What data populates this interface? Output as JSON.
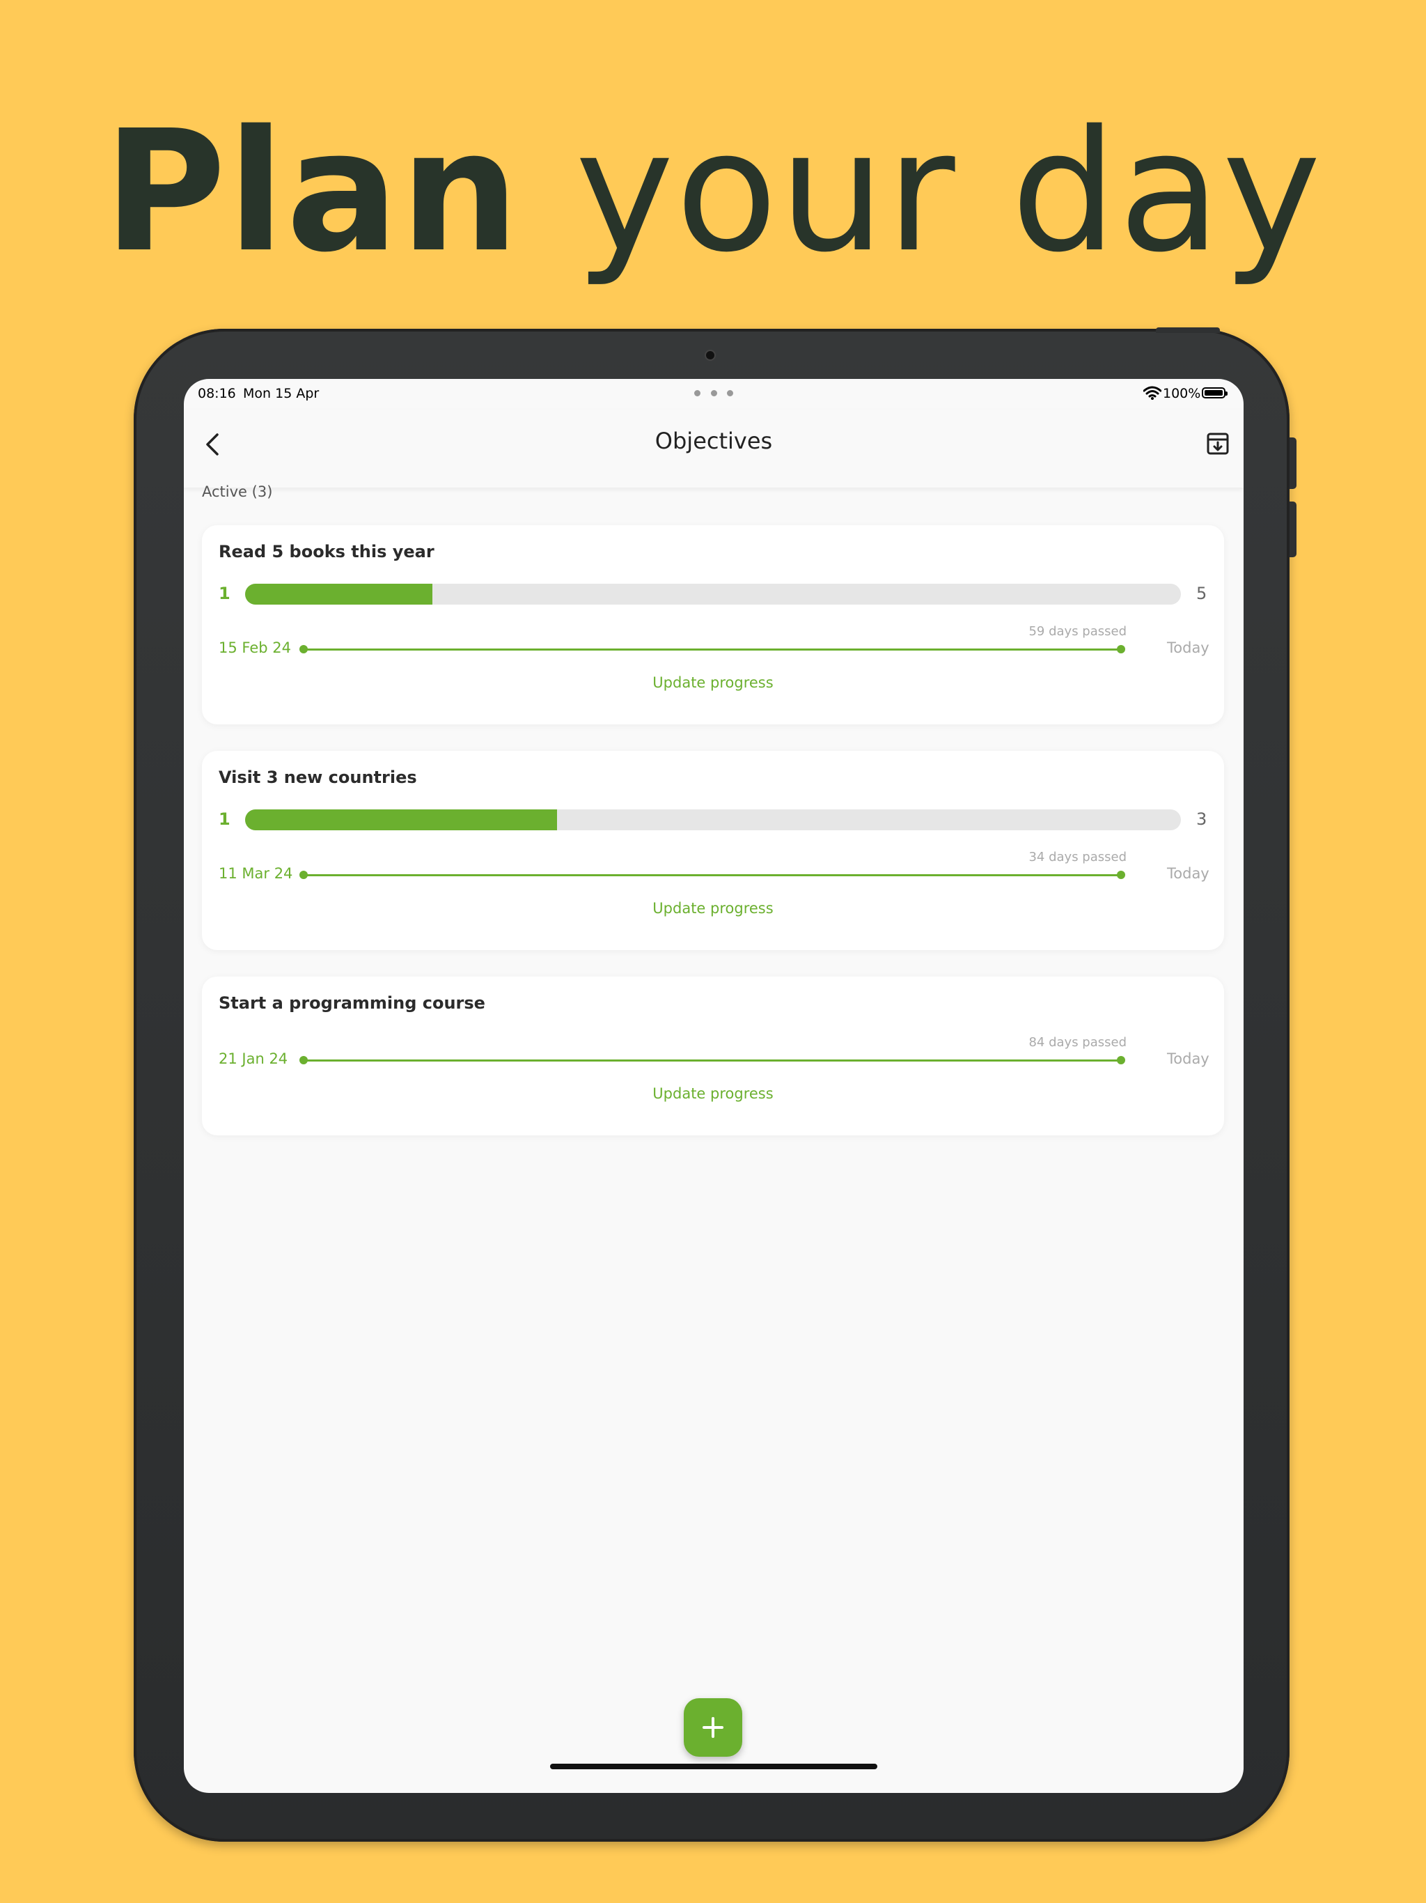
{
  "headline": {
    "bold": "Plan",
    "rest": "your day"
  },
  "status_bar": {
    "time": "08:16",
    "date": "Mon 15 Apr",
    "battery": "100%"
  },
  "nav": {
    "title": "Objectives"
  },
  "section": {
    "label": "Active (3)"
  },
  "objectives": [
    {
      "title": "Read 5 books this year",
      "current": "1",
      "target": "5",
      "progress": 0.2,
      "start_date": "15 Feb 24",
      "days_passed": "59 days passed",
      "end_label": "Today",
      "action": "Update progress"
    },
    {
      "title": "Visit 3 new countries",
      "current": "1",
      "target": "3",
      "progress": 0.333,
      "start_date": "11 Mar 24",
      "days_passed": "34 days passed",
      "end_label": "Today",
      "action": "Update progress"
    },
    {
      "title": "Start a programming course",
      "start_date": "21 Jan 24",
      "days_passed": "84 days passed",
      "end_label": "Today",
      "action": "Update progress"
    }
  ],
  "colors": {
    "background": "#FFCA57",
    "accent": "#6BB02F",
    "headline": "#28342A",
    "device": "#333536"
  },
  "icons": {
    "back": "chevron-left-icon",
    "archive": "archive-download-icon",
    "fab": "plus-icon",
    "wifi": "wifi-icon",
    "battery": "battery-icon"
  }
}
